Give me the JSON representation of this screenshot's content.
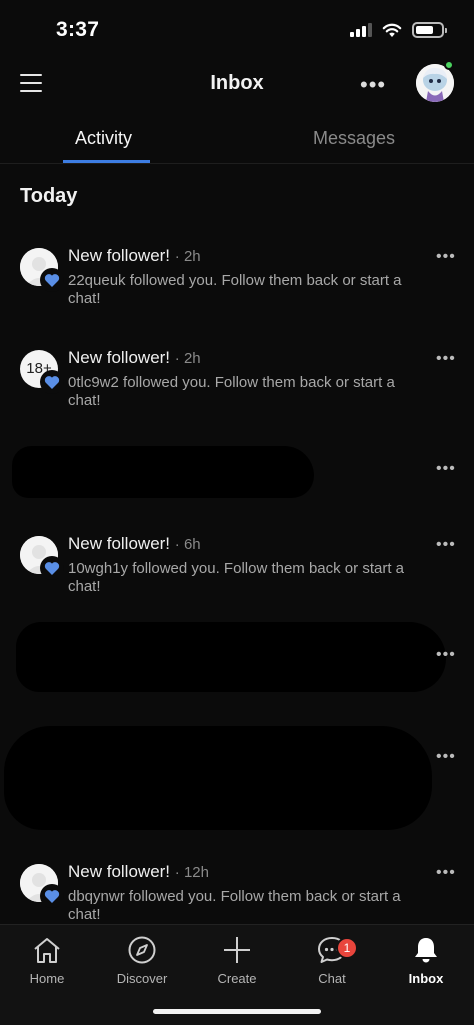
{
  "status": {
    "time": "3:37"
  },
  "header": {
    "title": "Inbox",
    "more_label": "•••"
  },
  "tabs": [
    {
      "label": "Activity",
      "active": true
    },
    {
      "label": "Messages",
      "active": false
    }
  ],
  "section": {
    "title": "Today"
  },
  "notifications": [
    {
      "title": "New follower!",
      "time": "· 2h",
      "body": "22queuk followed you. Follow them back or start a chat!",
      "avatar_text": ""
    },
    {
      "title": "New follower!",
      "time": "· 2h",
      "body": "0tlc9w2 followed you. Follow them back or start a chat!",
      "avatar_text": "18+"
    },
    {
      "title": "New follower!",
      "time": "· 6h",
      "body": "10wgh1y followed you. Follow them back or start a chat!",
      "avatar_text": ""
    },
    {
      "title": "New follower!",
      "time": "· 12h",
      "body": "dbqynwr followed you. Follow them back or start a chat!",
      "avatar_text": ""
    }
  ],
  "row_more_label": "•••",
  "bottom_nav": [
    {
      "label": "Home",
      "icon": "home-icon"
    },
    {
      "label": "Discover",
      "icon": "compass-icon"
    },
    {
      "label": "Create",
      "icon": "plus-icon"
    },
    {
      "label": "Chat",
      "icon": "chat-icon",
      "badge": "1"
    },
    {
      "label": "Inbox",
      "icon": "bell-icon",
      "active": true
    }
  ],
  "colors": {
    "accent": "#3d7de2",
    "badge": "#e8453c",
    "background": "#0b0b0b"
  }
}
